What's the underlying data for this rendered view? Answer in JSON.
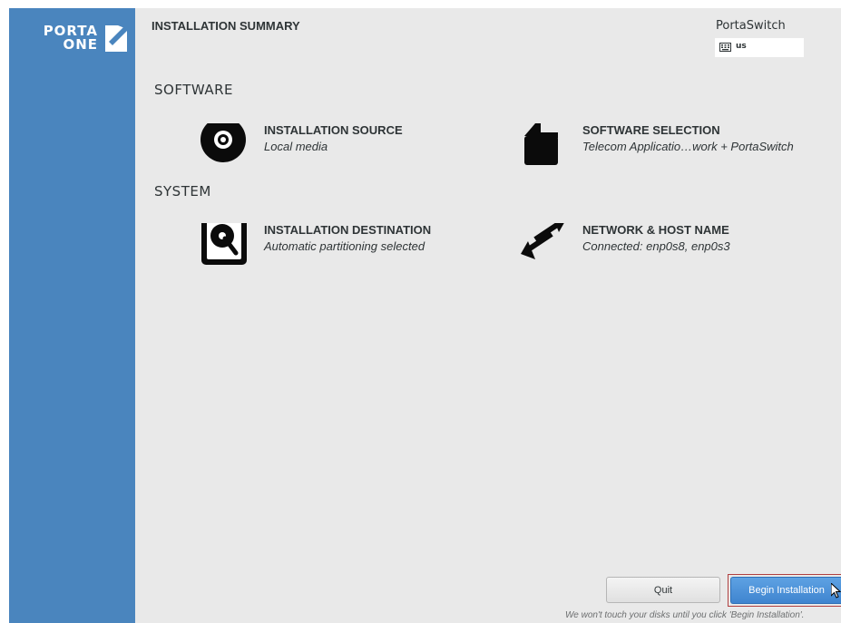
{
  "sidebar": {
    "logo": {
      "line1": "PORTA",
      "line2": "ONE",
      "icon": "check-box-icon"
    },
    "color": "#4a85be"
  },
  "header": {
    "title": "INSTALLATION SUMMARY",
    "product": "PortaSwitch",
    "keyboard": {
      "icon": "keyboard-icon",
      "layout": "us"
    }
  },
  "sections": [
    {
      "label": "SOFTWARE",
      "spokes": [
        {
          "title": "INSTALLATION SOURCE",
          "status": "Local media",
          "icon": "disc-icon"
        },
        {
          "title": "SOFTWARE SELECTION",
          "status": "Telecom Applicatio…work + PortaSwitch",
          "icon": "package-icon"
        }
      ]
    },
    {
      "label": "SYSTEM",
      "spokes": [
        {
          "title": "INSTALLATION DESTINATION",
          "status": "Automatic partitioning selected",
          "icon": "harddisk-icon"
        },
        {
          "title": "NETWORK & HOST NAME",
          "status": "Connected: enp0s8, enp0s3",
          "icon": "network-arrows-icon"
        }
      ]
    }
  ],
  "footer": {
    "quit_label": "Quit",
    "begin_label": "Begin Installation",
    "note": "We won't touch your disks until you click 'Begin Installation'."
  },
  "colors": {
    "accent": "#4a85be",
    "primary_button": "#4a8fd8",
    "background": "#e9e9e9"
  }
}
